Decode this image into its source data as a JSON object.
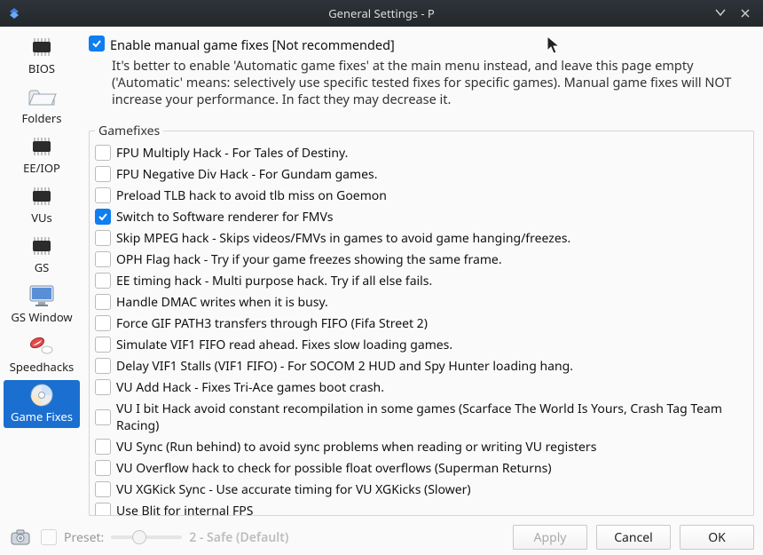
{
  "window": {
    "title": "General Settings - P"
  },
  "sidebar": {
    "items": [
      {
        "id": "bios",
        "label": "BIOS",
        "icon": "chip"
      },
      {
        "id": "folders",
        "label": "Folders",
        "icon": "folder"
      },
      {
        "id": "eeiop",
        "label": "EE/IOP",
        "icon": "chip"
      },
      {
        "id": "vus",
        "label": "VUs",
        "icon": "chip"
      },
      {
        "id": "gs",
        "label": "GS",
        "icon": "chip"
      },
      {
        "id": "gswindow",
        "label": "GS Window",
        "icon": "monitor"
      },
      {
        "id": "speedhacks",
        "label": "Speedhacks",
        "icon": "pills"
      },
      {
        "id": "gamefixes",
        "label": "Game Fixes",
        "icon": "disc",
        "selected": true
      }
    ]
  },
  "main": {
    "enable_label": "Enable manual game fixes [Not recommended]",
    "enable_checked": true,
    "description": "It's better to enable 'Automatic game fixes' at the main menu instead, and leave this page empty ('Automatic' means: selectively use specific tested fixes for specific games). Manual game fixes will NOT increase your performance. In fact they may decrease it.",
    "group_title": "Gamefixes",
    "fixes": [
      {
        "label": "FPU Multiply Hack - For Tales of Destiny.",
        "checked": false
      },
      {
        "label": "FPU Negative Div Hack - For Gundam games.",
        "checked": false
      },
      {
        "label": "Preload TLB hack to avoid tlb miss on Goemon",
        "checked": false
      },
      {
        "label": "Switch to Software renderer for FMVs",
        "checked": true
      },
      {
        "label": "Skip MPEG hack - Skips videos/FMVs in games to avoid game hanging/freezes.",
        "checked": false
      },
      {
        "label": "OPH Flag hack - Try if your game freezes showing the same frame.",
        "checked": false
      },
      {
        "label": "EE timing hack - Multi purpose hack. Try if all else fails.",
        "checked": false
      },
      {
        "label": "Handle DMAC writes when it is busy.",
        "checked": false
      },
      {
        "label": "Force GIF PATH3 transfers through FIFO (Fifa Street 2)",
        "checked": false
      },
      {
        "label": "Simulate VIF1 FIFO read ahead. Fixes slow loading games.",
        "checked": false
      },
      {
        "label": "Delay VIF1 Stalls (VIF1 FIFO) - For SOCOM 2 HUD and Spy Hunter loading hang.",
        "checked": false
      },
      {
        "label": "VU Add Hack - Fixes Tri-Ace games boot crash.",
        "checked": false
      },
      {
        "label": "VU I bit Hack avoid constant recompilation in some games (Scarface The World Is Yours, Crash Tag Team Racing)",
        "checked": false
      },
      {
        "label": "VU Sync (Run behind) to avoid sync problems when reading or writing VU registers",
        "checked": false
      },
      {
        "label": "VU Overflow hack to check for possible float overflows (Superman Returns)",
        "checked": false
      },
      {
        "label": "VU XGKick Sync - Use accurate timing for VU XGKicks (Slower)",
        "checked": false
      },
      {
        "label": "Use Blit for internal FPS",
        "checked": false
      }
    ]
  },
  "footer": {
    "preset_label": "Preset:",
    "preset_checked": false,
    "preset_value": "2 - Safe (Default)",
    "apply_label": "Apply",
    "cancel_label": "Cancel",
    "ok_label": "OK"
  }
}
